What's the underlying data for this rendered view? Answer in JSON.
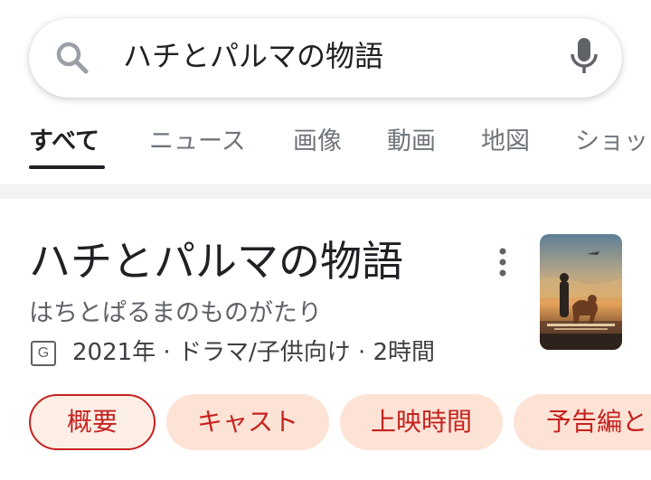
{
  "search": {
    "query": "ハチとパルマの物語"
  },
  "tabs": [
    {
      "label": "すべて",
      "active": true
    },
    {
      "label": "ニュース",
      "active": false
    },
    {
      "label": "画像",
      "active": false
    },
    {
      "label": "動画",
      "active": false
    },
    {
      "label": "地図",
      "active": false
    },
    {
      "label": "ショッ",
      "active": false
    }
  ],
  "knowledge_panel": {
    "title": "ハチとパルマの物語",
    "reading": "はちとぱるまのものがたり",
    "rating": "G",
    "meta": "2021年 · ドラマ/子供向け · 2時間"
  },
  "chips": [
    {
      "label": "概要",
      "selected": true
    },
    {
      "label": "キャスト",
      "selected": false
    },
    {
      "label": "上映時間",
      "selected": false
    },
    {
      "label": "予告編と"
    }
  ],
  "colors": {
    "chip_bg": "#fde3d6",
    "chip_text": "#c5221f",
    "tab_active": "#202124",
    "tab_inactive": "#70757a"
  }
}
